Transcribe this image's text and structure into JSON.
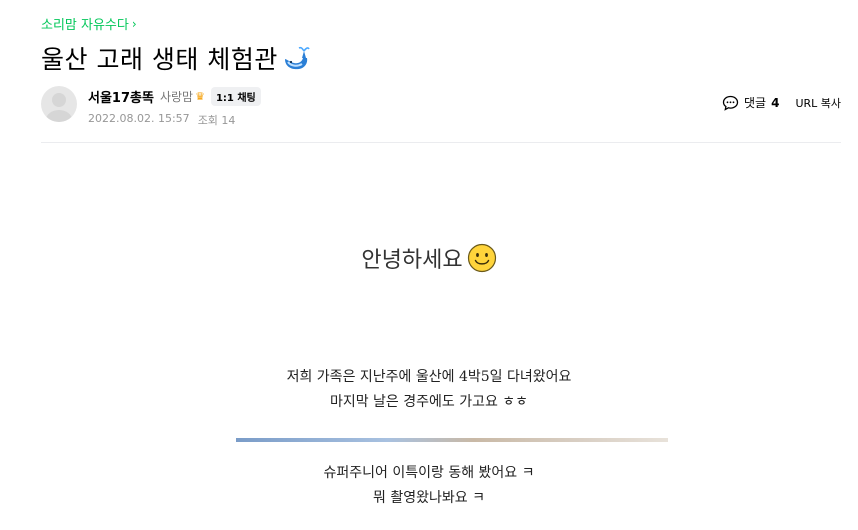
{
  "board": {
    "name": "소리맘 자유수다",
    "chevron": "›"
  },
  "post": {
    "title": "울산 고래 생태 체험관",
    "title_icon": "whale-icon"
  },
  "author": {
    "nickname": "서울17총똑",
    "grade": "사랑맘",
    "grade_icon": "crown-icon",
    "chat_label": "1:1 채팅",
    "date": "2022.08.02. 15:57",
    "views": "조회 14"
  },
  "tools": {
    "comment_label": "댓글",
    "comment_count": "4",
    "url_copy_label": "URL 복사"
  },
  "content": {
    "greeting": "안녕하세요",
    "greeting_icon": "smile-icon",
    "para1_line1": "저희 가족은 지난주에 울산에 4박5일 다녀왔어요",
    "para1_line2": "마지막 날은 경주에도 가고요 ㅎㅎ",
    "para2_line1": "슈퍼주니어 이특이랑 동해 봤어요 ㅋ",
    "para2_line2": "뭐 촬영왔나봐요 ㅋ"
  },
  "colors": {
    "accent": "#03c75a",
    "meta_text": "#979797",
    "divider": "#ebecef"
  }
}
